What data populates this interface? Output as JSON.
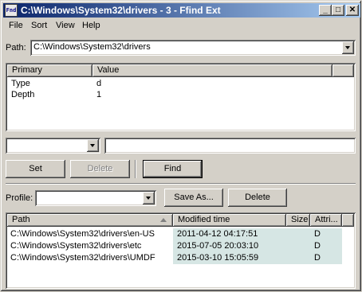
{
  "window": {
    "title": "C:\\Windows\\System32\\drivers - 3 - Ffind Ext",
    "icon": "ffind-app-icon",
    "icon_text": "Fnd",
    "buttons": {
      "minimize": "_",
      "maximize": "□",
      "close": "✕"
    }
  },
  "menu": [
    "File",
    "Sort",
    "View",
    "Help"
  ],
  "path": {
    "label": "Path:",
    "value": "C:\\Windows\\System32\\drivers"
  },
  "criteria": {
    "headers": [
      "Primary",
      "Value"
    ],
    "rows": [
      {
        "primary": "Type",
        "value": "d"
      },
      {
        "primary": "Depth",
        "value": "1"
      }
    ]
  },
  "editor": {
    "field_select": "",
    "field_value": ""
  },
  "buttons": {
    "set": "Set",
    "delete": "Delete",
    "find": "Find",
    "save_as": "Save As...",
    "profile_delete": "Delete"
  },
  "profile": {
    "label": "Profile:",
    "value": ""
  },
  "results": {
    "headers": [
      "Path",
      "Modified time",
      "Size",
      "Attri..."
    ],
    "rows": [
      {
        "path": "C:\\Windows\\System32\\drivers\\en-US",
        "modified": "2011-04-12 04:17:51",
        "size": "",
        "attr": "D"
      },
      {
        "path": "C:\\Windows\\System32\\drivers\\etc",
        "modified": "2015-07-05 20:03:10",
        "size": "",
        "attr": "D"
      },
      {
        "path": "C:\\Windows\\System32\\drivers\\UMDF",
        "modified": "2015-03-10 15:05:59",
        "size": "",
        "attr": "D"
      }
    ]
  },
  "colors": {
    "titlebar_start": "#0a246a",
    "titlebar_end": "#a6caf0",
    "face": "#d4d0c8",
    "result_highlight": "#d6e6e4"
  }
}
